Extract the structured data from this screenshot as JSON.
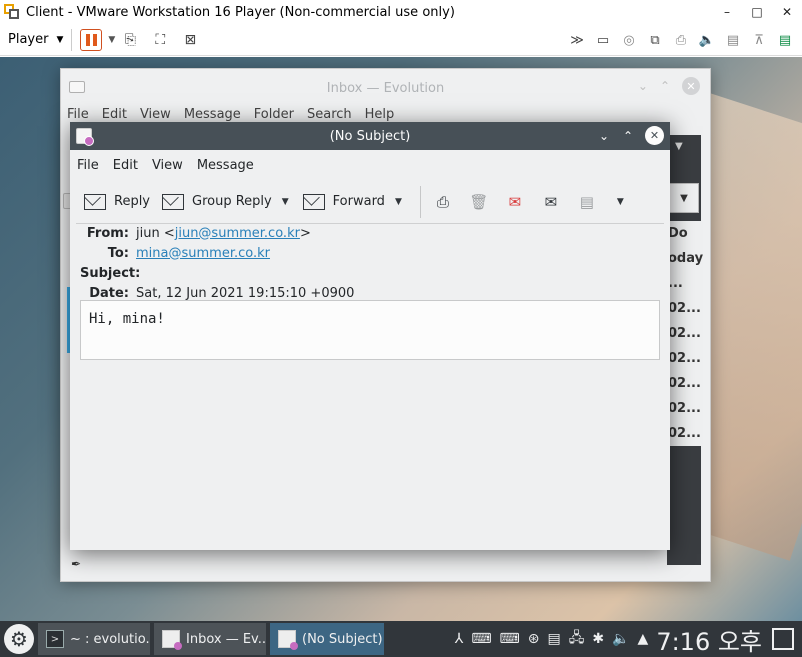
{
  "host": {
    "title": "Client - VMware Workstation 16 Player (Non-commercial use only)",
    "player_menu": "Player",
    "controls": {
      "minimize": "–",
      "maximize": "□",
      "close": "✕"
    }
  },
  "inbox_window": {
    "title": "Inbox — Evolution",
    "menu": [
      "File",
      "Edit",
      "View",
      "Message",
      "Folder",
      "Search",
      "Help"
    ],
    "partial_column": [
      "Do",
      "oday",
      "...",
      "02...",
      "02...",
      "02...",
      "02...",
      "02...",
      "02..."
    ]
  },
  "message_window": {
    "title": "(No Subject)",
    "menu": [
      "File",
      "Edit",
      "View",
      "Message"
    ],
    "toolbar": {
      "reply": "Reply",
      "group_reply": "Group Reply",
      "forward": "Forward"
    },
    "headers": {
      "from_label": "From:",
      "from_name": "jiun <",
      "from_email": "jiun@summer.co.kr",
      "from_close": ">",
      "to_label": "To:",
      "to_email": "mina@summer.co.kr",
      "subject_label": "Subject:",
      "subject_value": "",
      "date_label": "Date:",
      "date_value": "Sat, 12 Jun 2021 19:15:10 +0900"
    },
    "body": "Hi, mina!"
  },
  "taskbar": {
    "tasks": [
      "~ : evolutio...",
      "Inbox — Ev...",
      "(No Subject)"
    ],
    "clock": "7:16 오후"
  }
}
